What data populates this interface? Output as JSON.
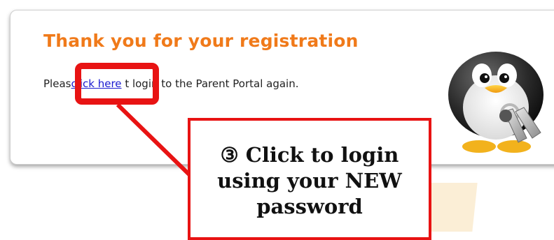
{
  "registration": {
    "title": "Thank you for your registration",
    "message_before": "Pleas",
    "link_label": "click here",
    "message_after": " t  login to the Parent Portal again."
  },
  "callout": {
    "marker": "③",
    "line1": "Click to login",
    "line2": "using your NEW",
    "line3": "password"
  },
  "colors": {
    "title": "#f07a1a",
    "highlight": "#e81313",
    "link": "#1a1ad0"
  },
  "icons": {
    "mascot": "penguin-with-keys-icon"
  }
}
